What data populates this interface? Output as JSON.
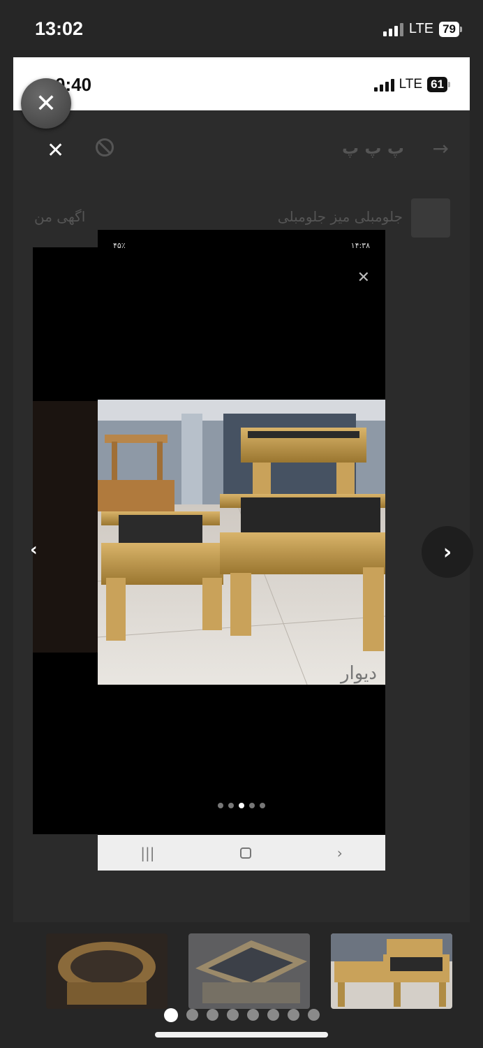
{
  "device_status": {
    "time": "13:02",
    "network": "LTE",
    "battery": "79"
  },
  "inner_screenshot": {
    "status": {
      "time": "0:40",
      "network": "LTE",
      "battery": "61"
    },
    "header": {
      "title": "پ پ پ"
    },
    "ad_row": {
      "name": "جلومبلی میز جلومبلی",
      "my_ad_label": "اگهی من"
    },
    "viewer": {
      "status_left": "۴۵٪",
      "status_right": "۱۴:۳۸",
      "watermark": "دیوار",
      "dots_count": 5,
      "active_dot": 2
    }
  },
  "gallery": {
    "page_count": 8,
    "active_page": 0
  },
  "icons": {
    "close": "close-icon",
    "next": "chevron-right-icon",
    "prev": "chevron-left-icon"
  }
}
